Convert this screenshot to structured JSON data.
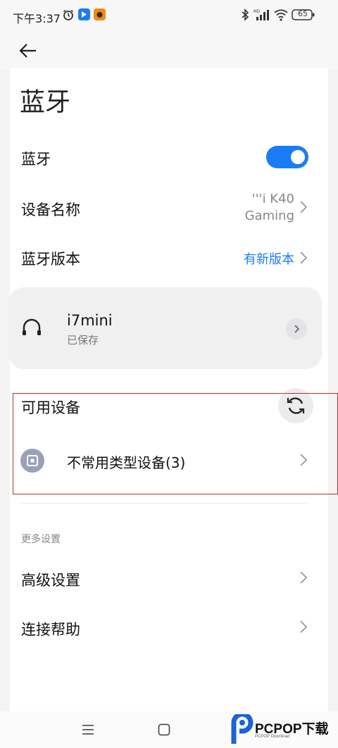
{
  "status_bar": {
    "time": "下午3:37",
    "battery": "65",
    "icons": [
      "alarm-icon",
      "app-icon-blue",
      "app-icon-orange",
      "bluetooth-icon",
      "signal-icon",
      "wifi-icon",
      "battery-icon"
    ]
  },
  "header": {
    "back_icon": "arrow-left-icon",
    "title": "蓝牙"
  },
  "settings": {
    "bluetooth_label": "蓝牙",
    "bluetooth_on": true,
    "device_name_label": "设备名称",
    "device_name_value_line1": "'''i K40",
    "device_name_value_line2": "Gaming",
    "bt_version_label": "蓝牙版本",
    "bt_version_value": "有新版本"
  },
  "saved_device": {
    "name": "i7mini",
    "status": "已保存",
    "icon": "headphones-icon"
  },
  "available": {
    "label": "可用设备",
    "refresh_icon": "refresh-icon",
    "uncommon_label": "不常用类型设备(3)",
    "uncommon_icon": "device-square-icon"
  },
  "more": {
    "section_label": "更多设置",
    "advanced_label": "高级设置",
    "help_label": "连接帮助"
  },
  "watermark": {
    "text": "PCPOP下载",
    "sub": "PCPOP Download"
  },
  "colors": {
    "accent": "#1a7cf5",
    "highlight_box": "#b03030"
  }
}
